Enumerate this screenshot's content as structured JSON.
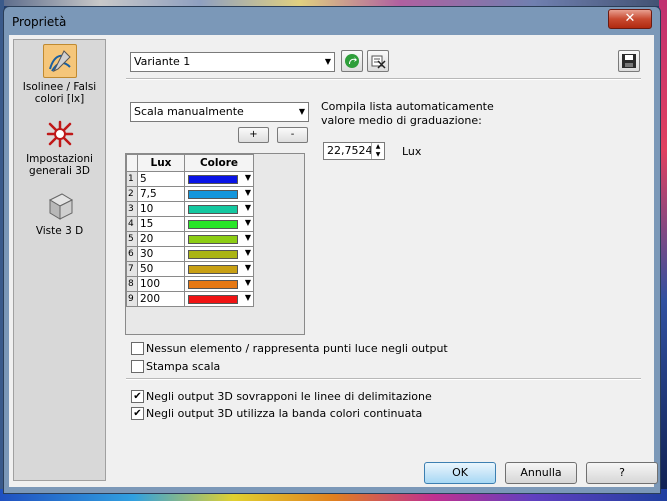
{
  "window": {
    "title": "Proprietà",
    "close_glyph": "✕"
  },
  "sidebar": {
    "items": [
      {
        "label_line1": "Isolinee / Falsi",
        "label_line2": "colori [lx]",
        "icon": "isolines-icon"
      },
      {
        "label_line1": "Impostazioni",
        "label_line2": "generali 3D",
        "icon": "settings-3d-icon"
      },
      {
        "label_line1": "Viste 3 D",
        "label_line2": "",
        "icon": "cube-icon"
      }
    ]
  },
  "variant": {
    "selected": "Variante 1"
  },
  "scale": {
    "mode": "Scala manualmente",
    "add_label": "+",
    "remove_label": "-",
    "autofill_line1": "Compila lista automaticamente",
    "autofill_line2": "valore medio di graduazione:",
    "value": "22,7524",
    "unit": "Lux"
  },
  "grid": {
    "headers": [
      "Lux",
      "Colore"
    ],
    "rows": [
      {
        "n": "1",
        "lux": "5",
        "color": "#0a14e6"
      },
      {
        "n": "2",
        "lux": "7,5",
        "color": "#1496dc"
      },
      {
        "n": "3",
        "lux": "10",
        "color": "#14c8a0"
      },
      {
        "n": "4",
        "lux": "15",
        "color": "#28e628"
      },
      {
        "n": "5",
        "lux": "20",
        "color": "#8ccd14"
      },
      {
        "n": "6",
        "lux": "30",
        "color": "#aab414"
      },
      {
        "n": "7",
        "lux": "50",
        "color": "#c8a014"
      },
      {
        "n": "8",
        "lux": "100",
        "color": "#e67814"
      },
      {
        "n": "9",
        "lux": "200",
        "color": "#f01414"
      }
    ]
  },
  "options": {
    "no_elements": {
      "label": "Nessun elemento / rappresenta punti luce negli output",
      "checked": false
    },
    "print_scale": {
      "label": "Stampa scala",
      "checked": false
    },
    "overlay_lines": {
      "label": "Negli output 3D sovrapponi le linee di delimitazione",
      "checked": true
    },
    "continuous_band": {
      "label": "Negli output 3D utilizza la banda colori continuata",
      "checked": true
    }
  },
  "buttons": {
    "ok": "OK",
    "cancel": "Annulla",
    "help": "?"
  }
}
